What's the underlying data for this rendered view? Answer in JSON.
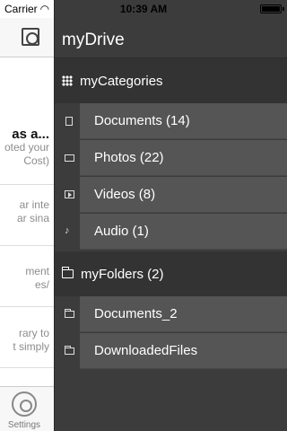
{
  "status_bar": {
    "carrier": "Carrier",
    "time": "10:39 AM"
  },
  "left_panel": {
    "snippets": [
      {
        "line1": "as a...",
        "line2": "oted your",
        "line3": "Cost)"
      },
      {
        "line1": "ar inte",
        "line2": "ar sina"
      },
      {
        "line1": "ment",
        "line2": "es/"
      },
      {
        "line1": "rary to",
        "line2": "t simply"
      }
    ],
    "tab_settings_label": "Settings"
  },
  "drawer": {
    "title": "myDrive",
    "categories": {
      "label": "myCategories",
      "items": [
        {
          "label": "Documents (14)",
          "icon": "document-icon"
        },
        {
          "label": "Photos (22)",
          "icon": "photo-icon"
        },
        {
          "label": "Videos (8)",
          "icon": "video-icon"
        },
        {
          "label": "Audio (1)",
          "icon": "audio-icon"
        }
      ]
    },
    "folders": {
      "label": "myFolders (2)",
      "items": [
        {
          "label": "Documents_2",
          "icon": "folder-icon"
        },
        {
          "label": "DownloadedFiles",
          "icon": "folder-icon"
        }
      ]
    }
  },
  "colors": {
    "drawer_bg": "#3c3c3c",
    "section_header_bg": "#333333",
    "sub_item_bg": "#555555"
  }
}
